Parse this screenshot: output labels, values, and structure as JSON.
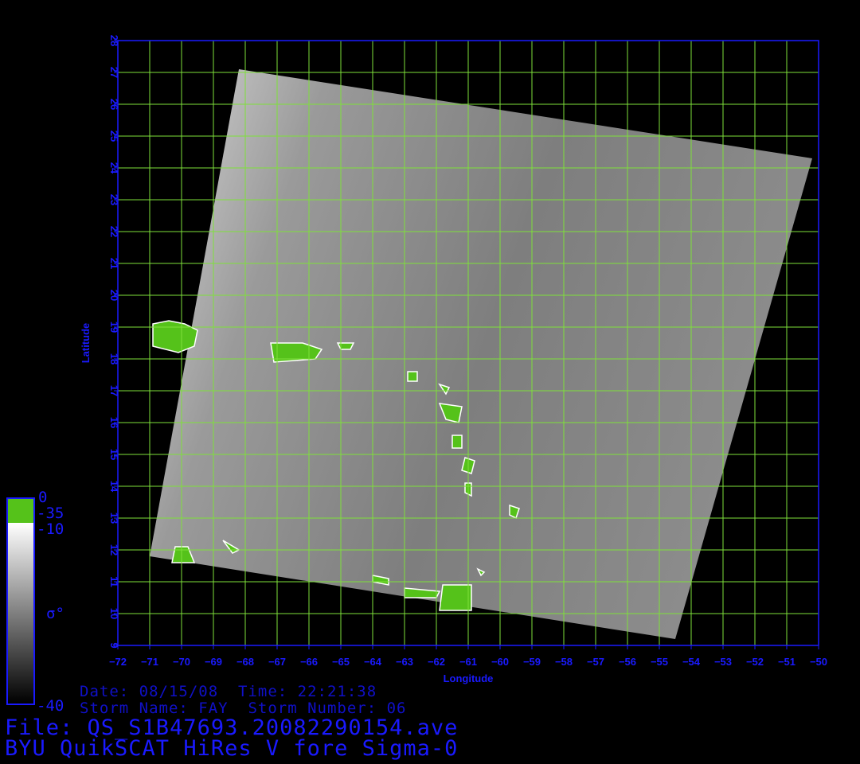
{
  "map": {
    "xlabel": "Longitude",
    "ylabel": "Latitude",
    "lon_range": [
      -72,
      -50
    ],
    "lat_range": [
      9,
      28
    ],
    "lon_ticks": [
      -72,
      -71,
      -70,
      -69,
      -68,
      -67,
      -66,
      -65,
      -64,
      -63,
      -62,
      -61,
      -60,
      -59,
      -58,
      -57,
      -56,
      -55,
      -54,
      -53,
      -52,
      -51,
      -50
    ],
    "lat_ticks": [
      9,
      10,
      11,
      12,
      13,
      14,
      15,
      16,
      17,
      18,
      19,
      20,
      21,
      22,
      23,
      24,
      25,
      26,
      27,
      28
    ],
    "grid": true,
    "grid_color": "#7ee03a",
    "frame_color": "#1a1aff",
    "land_color": "#55c21a",
    "swath_corners_lonlat": [
      [
        -68.2,
        27.1
      ],
      [
        -50.2,
        24.3
      ],
      [
        -54.5,
        9.2
      ],
      [
        -71.0,
        11.8
      ]
    ]
  },
  "colorbar": {
    "land_top": "0",
    "land_bottom": "-35",
    "top": "-10",
    "symbol": "σ°",
    "bottom": "-40"
  },
  "info": {
    "date_line": "Date: 08/15/08  Time: 22:21:38",
    "storm_line": "Storm Name: FAY  Storm Number: 06",
    "file_line": "File: QS_S1B47693.20082290154.ave",
    "product_line": "BYU QuikSCAT HiRes V fore Sigma-0"
  }
}
